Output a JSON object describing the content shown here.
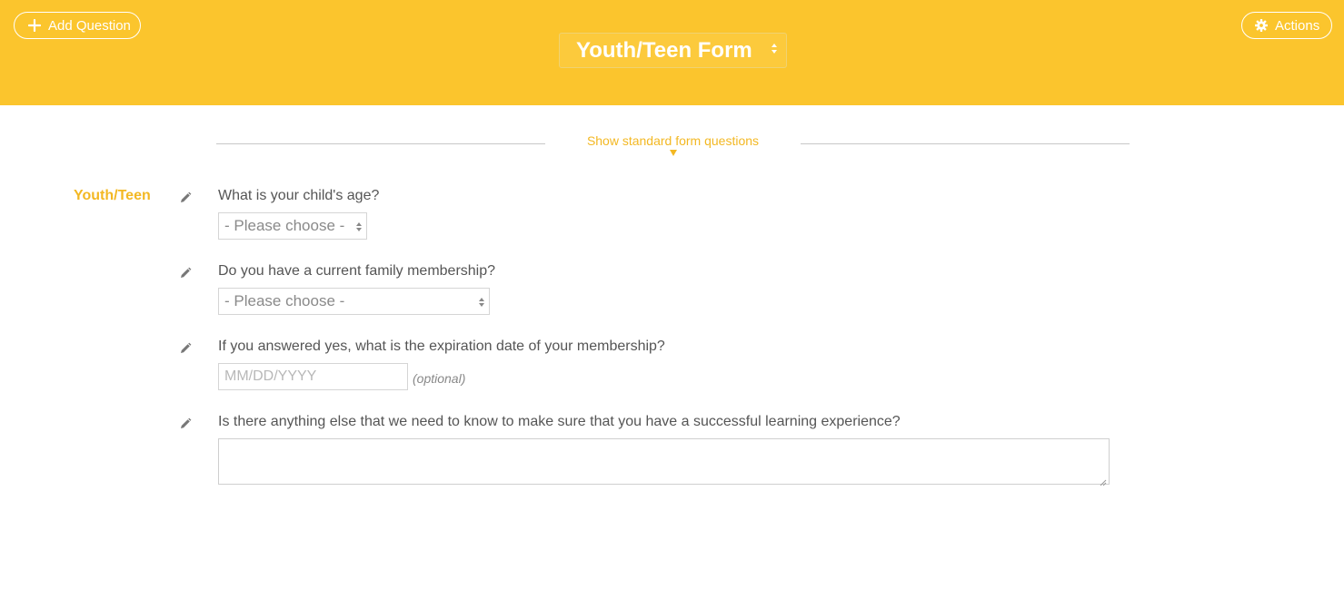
{
  "header": {
    "add_question_label": "Add Question",
    "actions_label": "Actions",
    "form_selector_value": "Youth/Teen Form"
  },
  "toggle": {
    "show_standard_label": "Show standard form questions"
  },
  "section": {
    "label": "Youth/Teen"
  },
  "questions": [
    {
      "text": "What is your child's age?",
      "input_value": "- Please choose -"
    },
    {
      "text": "Do you have a current family membership?",
      "input_value": "- Please choose -"
    },
    {
      "text": "If you answered yes, what is the expiration date of your membership?",
      "placeholder": "MM/DD/YYYY",
      "note": "(optional)"
    },
    {
      "text": "Is there anything else that we need to know to make sure that you have a successful learning experience?"
    }
  ],
  "colors": {
    "header_bg": "#fbc52d",
    "accent": "#f3b823",
    "text": "#555555"
  },
  "icons": {
    "add": "plus-icon",
    "actions": "gear-icon",
    "edit": "pencil-icon"
  }
}
